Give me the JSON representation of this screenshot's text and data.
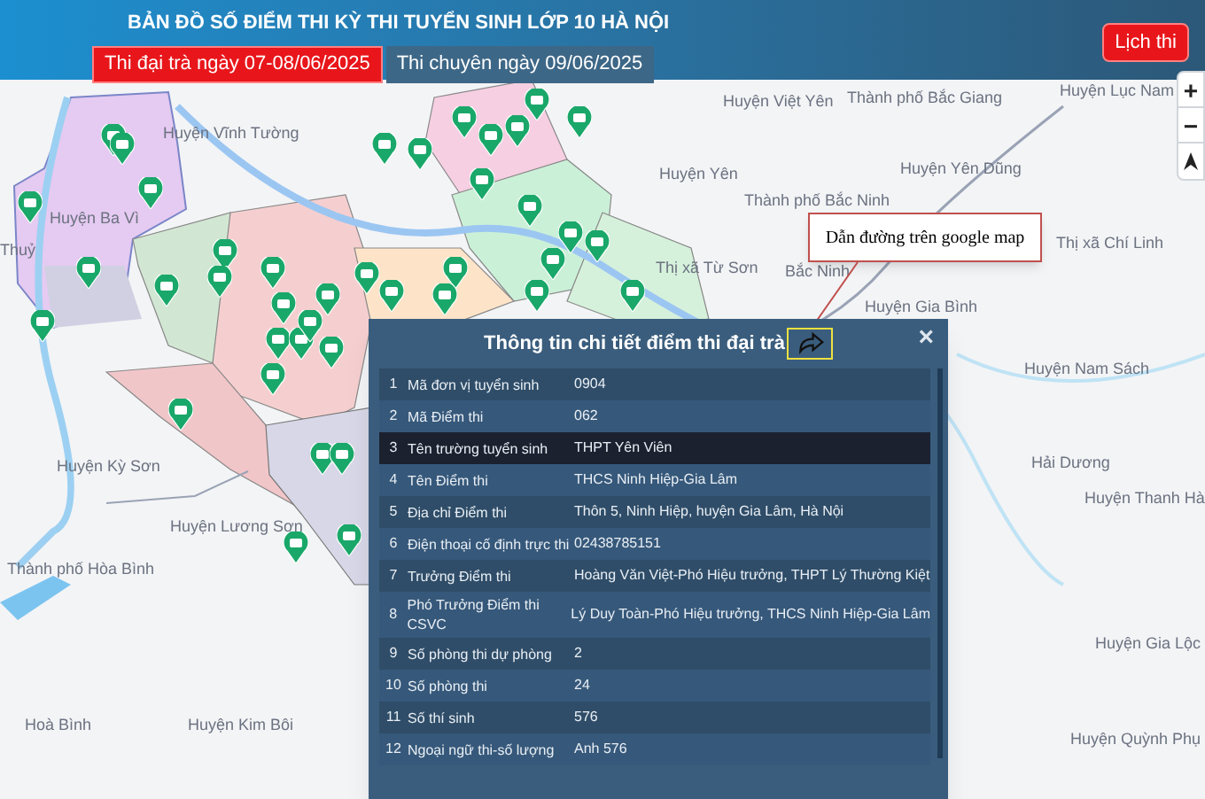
{
  "header": {
    "title": "BẢN ĐỒ SỐ ĐIỂM THI KỲ THI TUYỂN SINH LỚP 10 HÀ NỘI",
    "tabs": [
      {
        "label": "Thi đại trà ngày 07-08/06/2025",
        "selected": true
      },
      {
        "label": "Thi chuyên ngày 09/06/2025",
        "selected": false
      }
    ],
    "schedule_button": "Lịch thi"
  },
  "map_controls": [
    "+",
    "−"
  ],
  "map_labels": [
    "Huyện Vĩnh Tường",
    "Huyện Ba Vì",
    "Thuỷ",
    "Huyện Việt Yên",
    "Thành phố Bắc Giang",
    "Huyện Yên",
    "Huyện Yên Dũng",
    "Thành phố Bắc Ninh",
    "Thị xã Từ Sơn",
    "Bắc Ninh",
    "Huyện Gia Bình",
    "Thị xã Chí Linh",
    "Huyện Nam Sách",
    "Hải Dương",
    "Huyện Thanh Hà",
    "Huyện Kỳ Sơn",
    "Huyện Lương Sơn",
    "Thành phố Hòa Bình",
    "Hoà Bình",
    "Huyện Kim Bôi",
    "Huyện Lục Nam",
    "Huyện Gia Lộc",
    "Huyện Quỳnh Phụ"
  ],
  "callout": "Dẫn đường trên google map",
  "popup": {
    "title": "Thông tin chi tiết điểm thi đại trà",
    "close": "×",
    "rows": [
      {
        "number": "1",
        "label": "Mã đơn vị tuyển sinh",
        "value": "0904",
        "selected": false
      },
      {
        "number": "2",
        "label": "Mã Điểm thi",
        "value": "062",
        "selected": false
      },
      {
        "number": "3",
        "label": "Tên trường tuyển sinh",
        "value": "THPT Yên Viên",
        "selected": true
      },
      {
        "number": "4",
        "label": "Tên Điểm thi",
        "value": "THCS Ninh Hiệp-Gia Lâm",
        "selected": false
      },
      {
        "number": "5",
        "label": "Địa chỉ Điểm thi",
        "value": "Thôn 5, Ninh Hiệp, huyện Gia Lâm, Hà Nội",
        "selected": false
      },
      {
        "number": "6",
        "label": "Điện thoại cố định trực thi",
        "value": "02438785151",
        "selected": false
      },
      {
        "number": "7",
        "label": "Trưởng Điểm thi",
        "value": "Hoàng Văn Việt-Phó Hiệu trưởng, THPT Lý Thường Kiệt",
        "selected": false
      },
      {
        "number": "8",
        "label": "Phó Trưởng Điểm thi CSVC",
        "value": "Lý Duy Toàn-Phó Hiệu trưởng, THCS Ninh Hiệp-Gia Lâm",
        "selected": false
      },
      {
        "number": "9",
        "label": "Số phòng thi dự phòng",
        "value": "2",
        "selected": false
      },
      {
        "number": "10",
        "label": "Số phòng thi",
        "value": "24",
        "selected": false
      },
      {
        "number": "11",
        "label": "Số thí sinh",
        "value": "576",
        "selected": false
      },
      {
        "number": "12",
        "label": "Ngoại ngữ thi-số lượng",
        "value": "Anh 576",
        "selected": false
      }
    ]
  }
}
